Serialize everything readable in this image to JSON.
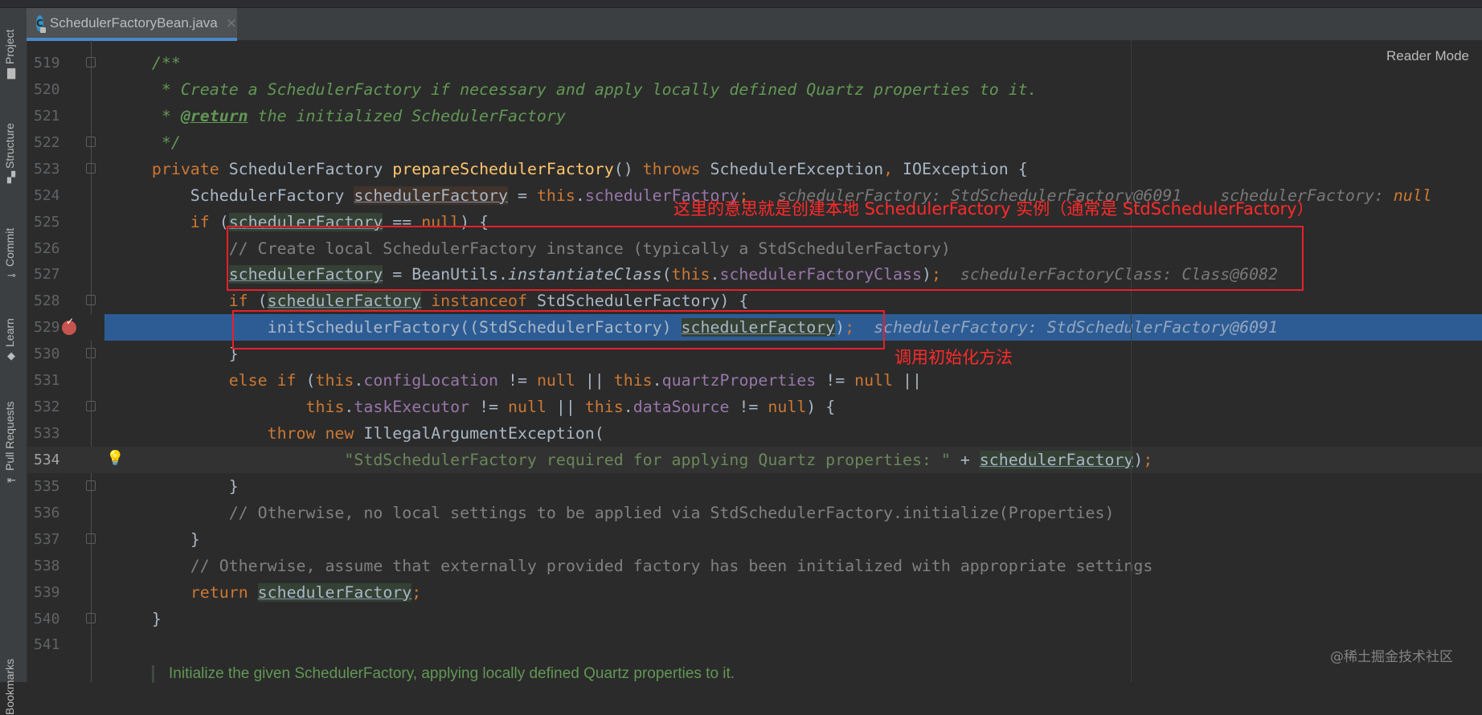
{
  "tab": {
    "title": "SchedulerFactoryBean.java",
    "icon": "java-class-icon",
    "close": "×",
    "icon_letter": "C"
  },
  "sidebar": {
    "items": [
      {
        "label": "Project",
        "icon": "folder-icon"
      },
      {
        "label": "Structure",
        "icon": "structure-icon"
      },
      {
        "label": "Commit",
        "icon": "commit-icon"
      },
      {
        "label": "Learn",
        "icon": "graduation-cap-icon"
      },
      {
        "label": "Pull Requests",
        "icon": "pull-request-icon"
      },
      {
        "label": "Bookmarks",
        "icon": "bookmark-icon"
      }
    ]
  },
  "editor": {
    "reader_mode": "Reader Mode",
    "execution_line": 529,
    "caret_line": 534,
    "breakpoint_line": 529,
    "bulb_line": 534,
    "fold_lines": [
      519,
      522,
      523,
      528,
      530,
      532,
      535,
      537,
      540
    ],
    "lines": [
      {
        "n": "519",
        "t": [
          [
            "    /**",
            "doc"
          ]
        ]
      },
      {
        "n": "520",
        "t": [
          [
            "     * Create a SchedulerFactory if necessary and apply locally defined Quartz properties to it.",
            "doc"
          ]
        ]
      },
      {
        "n": "521",
        "t": [
          [
            "     * ",
            "doc"
          ],
          [
            "@return",
            "doctag"
          ],
          [
            " the initialized SchedulerFactory",
            "doc"
          ]
        ]
      },
      {
        "n": "522",
        "t": [
          [
            "     */",
            "doc"
          ]
        ]
      },
      {
        "n": "523",
        "t": [
          [
            "    ",
            ""
          ],
          [
            "private",
            "kw"
          ],
          [
            " SchedulerFactory ",
            ""
          ],
          [
            "prepareSchedulerFactory",
            "method"
          ],
          [
            "() ",
            ""
          ],
          [
            "throws",
            "kw"
          ],
          [
            " SchedulerException",
            ""
          ],
          [
            ",",
            "kw"
          ],
          [
            " IOException {",
            ""
          ]
        ]
      },
      {
        "n": "524",
        "t": [
          [
            "        SchedulerFactory ",
            ""
          ],
          [
            "schedulerFactory",
            "vardecl"
          ],
          [
            " = ",
            ""
          ],
          [
            "this",
            "kw"
          ],
          [
            ".",
            ""
          ],
          [
            "schedulerFactory",
            "field"
          ],
          [
            ";",
            "kw"
          ],
          [
            "   schedulerFactory: StdSchedulerFactory@6091    schedulerFactory: ",
            "hint"
          ],
          [
            "null",
            "hintnull"
          ]
        ]
      },
      {
        "n": "525",
        "t": [
          [
            "        ",
            ""
          ],
          [
            "if",
            "kw"
          ],
          [
            " (",
            ""
          ],
          [
            "schedulerFactory",
            "var"
          ],
          [
            " == ",
            ""
          ],
          [
            "null",
            "kw"
          ],
          [
            ") {",
            ""
          ]
        ]
      },
      {
        "n": "526",
        "t": [
          [
            "            // Create local SchedulerFactory instance (typically a StdSchedulerFactory)",
            "cm"
          ]
        ]
      },
      {
        "n": "527",
        "t": [
          [
            "            ",
            ""
          ],
          [
            "schedulerFactory",
            "var"
          ],
          [
            " = BeanUtils.",
            ""
          ],
          [
            "instantiateClass",
            "it"
          ],
          [
            "(",
            ""
          ],
          [
            "this",
            "kw"
          ],
          [
            ".",
            ""
          ],
          [
            "schedulerFactoryClass",
            "field"
          ],
          [
            ")",
            ""
          ],
          [
            ";",
            "kw"
          ],
          [
            "  schedulerFactoryClass: Class@6082",
            "hint"
          ]
        ]
      },
      {
        "n": "528",
        "t": [
          [
            "            ",
            ""
          ],
          [
            "if",
            "kw"
          ],
          [
            " (",
            ""
          ],
          [
            "schedulerFactory",
            "var"
          ],
          [
            " ",
            ""
          ],
          [
            "instanceof",
            "kw"
          ],
          [
            " StdSchedulerFactory) {",
            ""
          ]
        ]
      },
      {
        "n": "529",
        "t": [
          [
            "                initSchedulerFactory((StdSchedulerFactory) ",
            ""
          ],
          [
            "schedulerFactory",
            "var"
          ],
          [
            ")",
            ""
          ],
          [
            ";",
            "kw"
          ],
          [
            "  schedulerFactory: StdSchedulerFactory@6091",
            "hint"
          ]
        ]
      },
      {
        "n": "530",
        "t": [
          [
            "            }",
            ""
          ]
        ]
      },
      {
        "n": "531",
        "t": [
          [
            "            ",
            ""
          ],
          [
            "else if",
            "kw"
          ],
          [
            " (",
            ""
          ],
          [
            "this",
            "kw"
          ],
          [
            ".",
            ""
          ],
          [
            "configLocation",
            "field"
          ],
          [
            " != ",
            ""
          ],
          [
            "null",
            "kw"
          ],
          [
            " || ",
            ""
          ],
          [
            "this",
            "kw"
          ],
          [
            ".",
            ""
          ],
          [
            "quartzProperties",
            "field"
          ],
          [
            " != ",
            ""
          ],
          [
            "null",
            "kw"
          ],
          [
            " ||",
            ""
          ]
        ]
      },
      {
        "n": "532",
        "t": [
          [
            "                    ",
            ""
          ],
          [
            "this",
            "kw"
          ],
          [
            ".",
            ""
          ],
          [
            "taskExecutor",
            "field"
          ],
          [
            " != ",
            ""
          ],
          [
            "null",
            "kw"
          ],
          [
            " || ",
            ""
          ],
          [
            "this",
            "kw"
          ],
          [
            ".",
            ""
          ],
          [
            "dataSource",
            "field"
          ],
          [
            " != ",
            ""
          ],
          [
            "null",
            "kw"
          ],
          [
            ") {",
            ""
          ]
        ]
      },
      {
        "n": "533",
        "t": [
          [
            "                ",
            ""
          ],
          [
            "throw new",
            "kw"
          ],
          [
            " IllegalArgumentException(",
            ""
          ]
        ]
      },
      {
        "n": "534",
        "t": [
          [
            "                        ",
            ""
          ],
          [
            "\"StdSchedulerFactory required for applying Quartz properties: \"",
            "str"
          ],
          [
            " + ",
            ""
          ],
          [
            "schedulerFactory",
            "var"
          ],
          [
            ")",
            ""
          ],
          [
            ";",
            "kw"
          ]
        ]
      },
      {
        "n": "535",
        "t": [
          [
            "            }",
            ""
          ]
        ]
      },
      {
        "n": "536",
        "t": [
          [
            "            // Otherwise, no local settings to be applied via StdSchedulerFactory.initialize(Properties)",
            "cm"
          ]
        ]
      },
      {
        "n": "537",
        "t": [
          [
            "        }",
            ""
          ]
        ]
      },
      {
        "n": "538",
        "t": [
          [
            "        // Otherwise, assume that externally provided factory has been initialized with appropriate settings",
            "cm"
          ]
        ]
      },
      {
        "n": "539",
        "t": [
          [
            "        ",
            ""
          ],
          [
            "return",
            "kw"
          ],
          [
            " ",
            ""
          ],
          [
            "schedulerFactory",
            "var"
          ],
          [
            ";",
            "kw"
          ]
        ]
      },
      {
        "n": "540",
        "t": [
          [
            "    }",
            ""
          ]
        ]
      },
      {
        "n": "541",
        "t": []
      }
    ],
    "rendered_doc": "Initialize the given SchedulerFactory, applying locally defined Quartz properties to it."
  },
  "annotations": {
    "note1": "这里的意思就是创建本地 SchedulerFactory 实例（通常是 StdSchedulerFactory）",
    "note2": "调用初始化方法",
    "color": "#e8202a"
  },
  "watermark": "@稀土掘金技术社区",
  "colors": {
    "execution_highlight": "#2d5c94",
    "background": "#2b2b2b",
    "keyword": "#cc7832",
    "doc_comment": "#629755",
    "field": "#9876aa"
  }
}
